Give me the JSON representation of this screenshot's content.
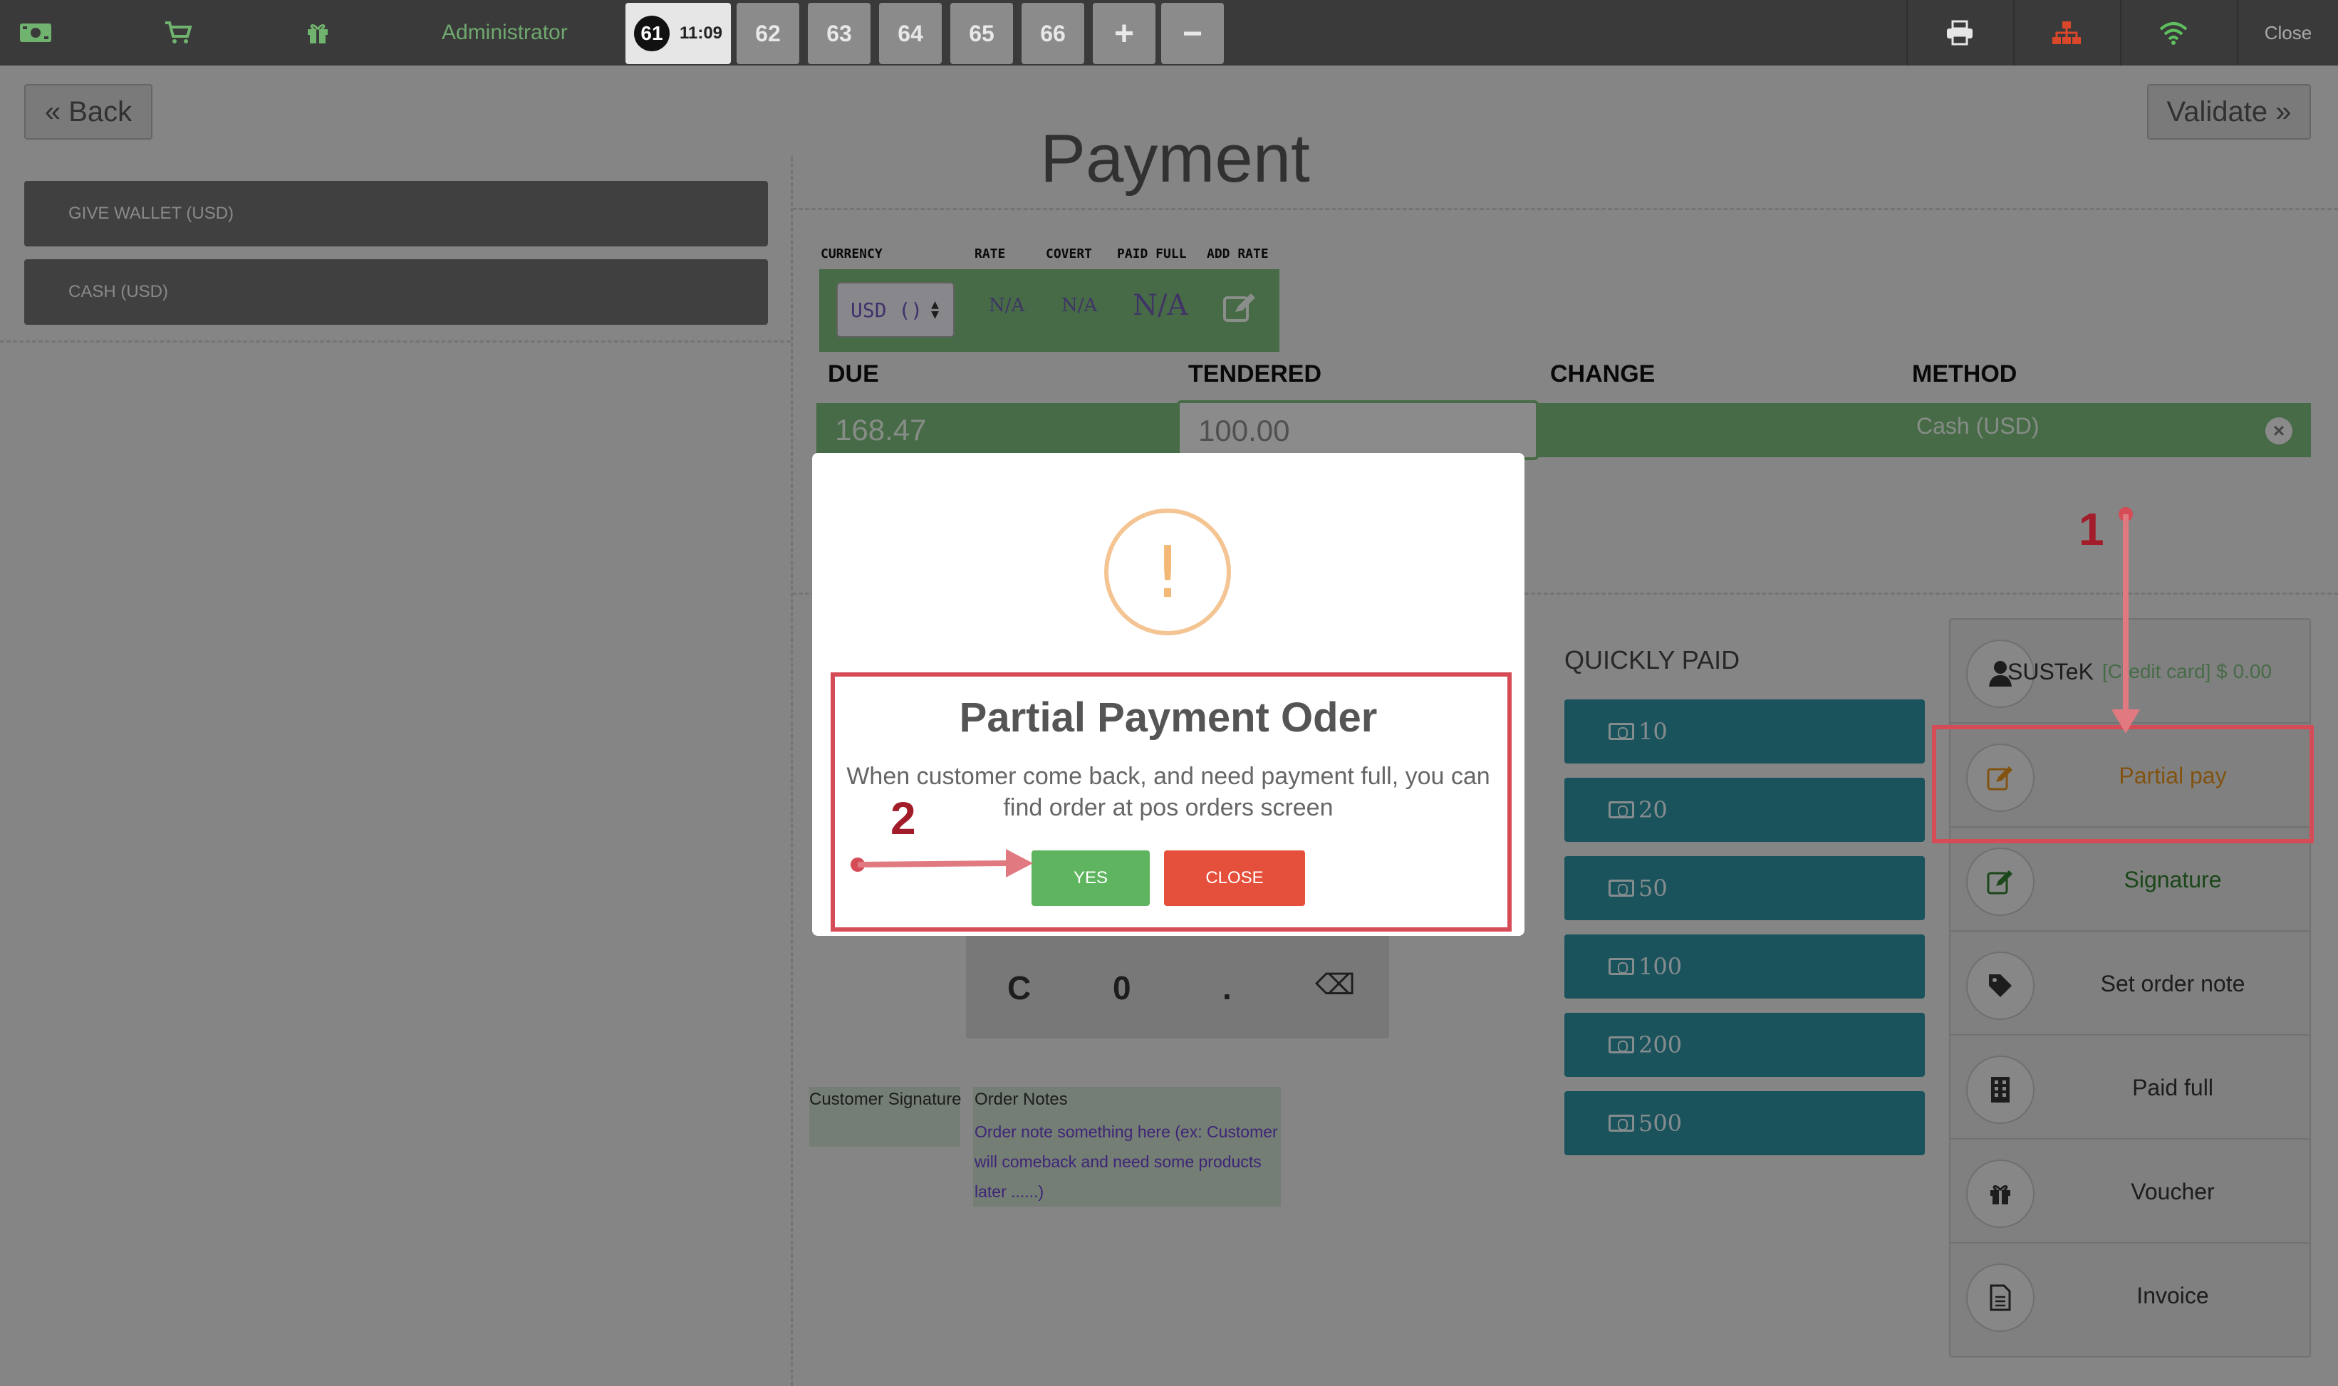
{
  "topbar": {
    "user": "Administrator",
    "active_order": {
      "number": "61",
      "time": "11:09"
    },
    "orders": [
      "62",
      "63",
      "64",
      "65",
      "66"
    ],
    "add_label": "+",
    "remove_label": "−",
    "close_label": "Close",
    "icons": [
      "money-icon",
      "cart-icon",
      "gift-icon",
      "printer-icon",
      "network-icon",
      "wifi-icon"
    ]
  },
  "payment": {
    "back_label": "« Back",
    "validate_label": "Validate »",
    "title": "Payment",
    "wallets": [
      "GIVE WALLET (USD)",
      "CASH (USD)"
    ],
    "currency_headers": {
      "currency": "CURRENCY",
      "rate": "RATE",
      "covert": "COVERT",
      "paid_full": "PAID FULL",
      "add_rate": "ADD RATE"
    },
    "currency_select": "USD  ()",
    "rate_value": "N/A",
    "covert_value": "N/A",
    "paid_full_value": "N/A",
    "columns": {
      "due": "DUE",
      "tendered": "TENDERED",
      "change": "CHANGE",
      "method": "METHOD"
    },
    "line": {
      "due": "168.47",
      "tendered": "100.00",
      "change": "",
      "method": "Cash (USD)"
    },
    "quickly_paid_title": "QUICKLY PAID",
    "quick_amounts": [
      "10",
      "20",
      "50",
      "100",
      "200",
      "500"
    ],
    "numpad": {
      "clear": "C",
      "zero": "0",
      "dot": ".",
      "backspace": "⌫"
    },
    "customer_signature_label": "Customer Signature",
    "order_notes_label": "Order Notes",
    "order_notes_text": "Order note something here (ex: Customer will comeback and need some products later ......)"
  },
  "side_panel": {
    "customer": {
      "name": "SUSTeK",
      "detail": "[Credit card] $ 0.00"
    },
    "items": [
      "Partial pay",
      "Signature",
      "Set order note",
      "Paid full",
      "Voucher",
      "Invoice"
    ]
  },
  "modal": {
    "icon": "!",
    "title": "Partial Payment Oder",
    "text": "When customer come back, and need payment full, you can find order at pos orders screen",
    "yes_label": "YES",
    "close_label": "CLOSE"
  },
  "annotations": {
    "step1": "1",
    "step2": "2"
  },
  "colors": {
    "accent_green": "#79b879",
    "quick_teal": "#2f8fa0",
    "annotation_red": "#d64c56",
    "yes_green": "#5fb55f",
    "close_red": "#e5503c",
    "warn_orange": "#f3b776"
  }
}
